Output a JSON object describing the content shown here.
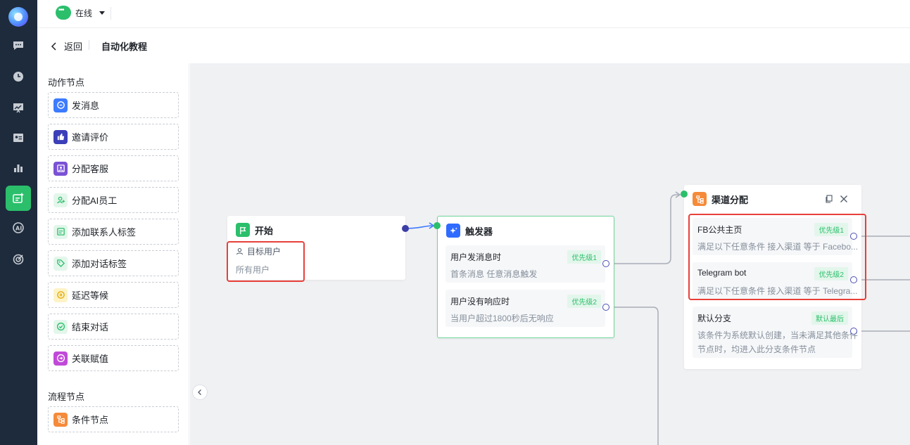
{
  "status": {
    "label": "在线"
  },
  "header": {
    "back_label": "返回",
    "title": "自动化教程"
  },
  "palette": {
    "action_title": "动作节点",
    "actions": [
      {
        "label": "发消息",
        "icon": "message-icon",
        "color": "#3d7bff"
      },
      {
        "label": "邀请评价",
        "icon": "thumb-up-icon",
        "color": "#3b3fb8"
      },
      {
        "label": "分配客服",
        "icon": "agent-icon",
        "color": "#7a52d6"
      },
      {
        "label": "分配AI员工",
        "icon": "ai-agent-icon",
        "color": "#2bbf6b"
      },
      {
        "label": "添加联系人标签",
        "icon": "contact-tag-icon",
        "color": "#2bbf6b"
      },
      {
        "label": "添加对话标签",
        "icon": "tag-icon",
        "color": "#2bbf6b"
      },
      {
        "label": "延迟等候",
        "icon": "delay-icon",
        "color": "#f5c518"
      },
      {
        "label": "结束对话",
        "icon": "check-circle-icon",
        "color": "#2bbf6b"
      },
      {
        "label": "关联赋值",
        "icon": "link-icon",
        "color": "#c04ad8"
      }
    ],
    "flow_title": "流程节点",
    "flows": [
      {
        "label": "条件节点",
        "icon": "branch-icon",
        "color": "#f58b3a"
      }
    ]
  },
  "start_node": {
    "title": "开始",
    "target_label": "目标用户",
    "target_value": "所有用户"
  },
  "trigger_node": {
    "title": "触发器",
    "conditions": [
      {
        "title": "用户发消息时",
        "badge": "优先级1",
        "desc": "首条消息  任意消息触发"
      },
      {
        "title": "用户没有响应时",
        "badge": "优先级2",
        "desc": "当用户超过1800秒后无响应"
      }
    ]
  },
  "channel_node": {
    "title": "渠道分配",
    "branches": [
      {
        "title": "FB公共主页",
        "badge": "优先级1",
        "desc": "满足以下任意条件  接入渠道  等于  Facebo..."
      },
      {
        "title": "Telegram bot",
        "badge": "优先级2",
        "desc": "满足以下任意条件  接入渠道  等于  Telegra..."
      }
    ],
    "default_branch": {
      "title": "默认分支",
      "badge": "默认最后",
      "desc_line1": "该条件为系统默认创建，当未满足其他条件",
      "desc_line2": "节点时，均进入此分支条件节点"
    }
  },
  "colors": {
    "accent": "#2bbf6b",
    "nav_bg": "#1d2b3c",
    "highlight": "#e8403a",
    "port": "#4b4fb5"
  }
}
